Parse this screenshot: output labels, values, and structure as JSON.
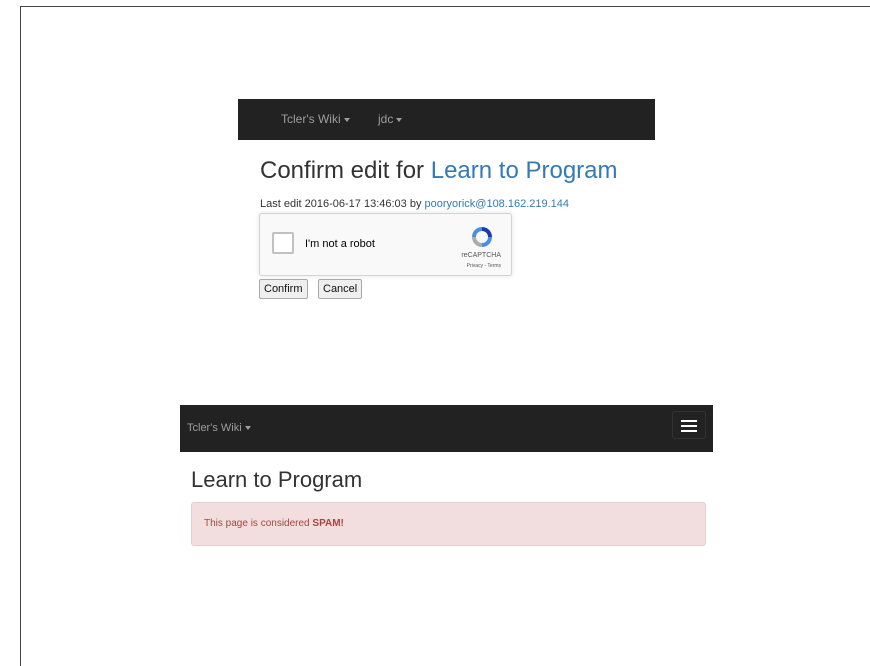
{
  "top": {
    "nav": {
      "brand_label": "Tcler's Wiki",
      "user_label": "jdc"
    },
    "heading_prefix": "Confirm edit for",
    "heading_link": "Learn to Program",
    "last_edit_prefix": "Last edit 2016-06-17 13:46:03 by",
    "last_edit_user": "pooryorick",
    "last_edit_ip": "@108.162.219.144",
    "recaptcha": {
      "checkbox_label": "I'm not a robot",
      "brand": "reCAPTCHA",
      "privacy": "Privacy",
      "separator": " - ",
      "terms": "Terms"
    },
    "confirm_label": "Confirm",
    "cancel_label": "Cancel"
  },
  "bottom": {
    "nav": {
      "brand_label": "Tcler's Wiki"
    },
    "heading": "Learn to Program",
    "alert_prefix": "This page is considered",
    "alert_emphasis": "SPAM!"
  },
  "colors": {
    "navbar_bg": "#222222",
    "nav_text": "#9d9d9d",
    "link": "#337ab7",
    "alert_bg": "#f2dede",
    "alert_text": "#a94442"
  },
  "icons": [
    "caret-down-icon",
    "recaptcha-logo-icon",
    "hamburger-menu-icon"
  ]
}
